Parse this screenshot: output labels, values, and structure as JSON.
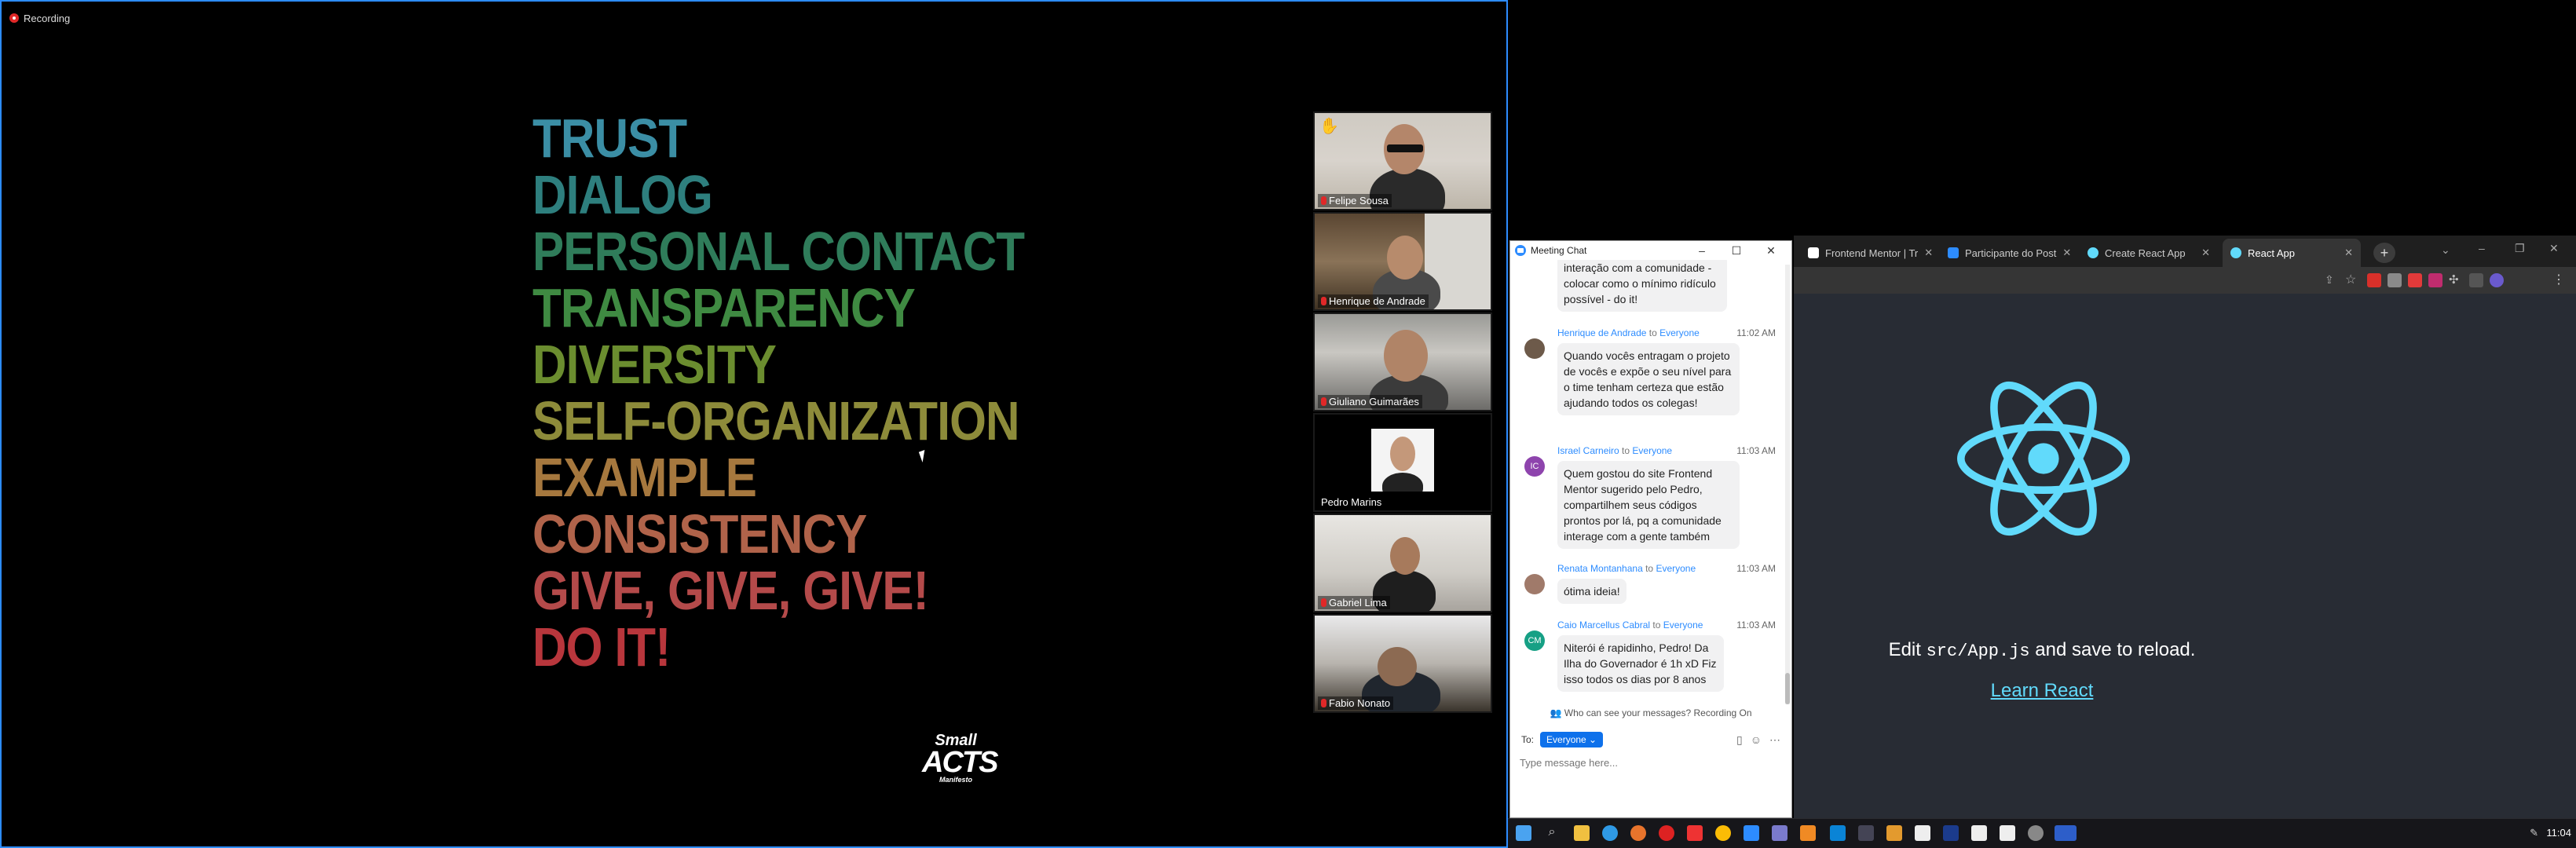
{
  "recording": {
    "label": "Recording"
  },
  "slide": {
    "words": [
      {
        "text": "TRUST",
        "color": "#3b8ea5"
      },
      {
        "text": "DIALOG",
        "color": "#2e7f7e"
      },
      {
        "text": "PERSONAL CONTACT",
        "color": "#2f7c5a"
      },
      {
        "text": "TRANSPARENCY",
        "color": "#3f8a42"
      },
      {
        "text": "DIVERSITY",
        "color": "#6b8d2f"
      },
      {
        "text": "SELF-ORGANIZATION",
        "color": "#8d8b3a"
      },
      {
        "text": "EXAMPLE",
        "color": "#a6783e"
      },
      {
        "text": "CONSISTENCY",
        "color": "#b0634a"
      },
      {
        "text": "GIVE, GIVE, GIVE!",
        "color": "#b44a4a"
      },
      {
        "text": "DO IT!",
        "color": "#b8363c"
      }
    ],
    "logo": {
      "line1": "Small",
      "line2": "ACTS",
      "line3": "Manifesto"
    }
  },
  "participants": [
    {
      "name": "Felipe Sousa",
      "raised_hand": true,
      "muted": true
    },
    {
      "name": "Henrique de Andrade",
      "raised_hand": false,
      "muted": true
    },
    {
      "name": "Giuliano Guimarães",
      "raised_hand": false,
      "muted": true
    },
    {
      "name": "Pedro Marins",
      "raised_hand": false,
      "muted": false
    },
    {
      "name": "Gabriel Lima",
      "raised_hand": false,
      "muted": true
    },
    {
      "name": "Fabio Nonato",
      "raised_hand": false,
      "muted": true
    }
  ],
  "chat": {
    "title": "Meeting Chat",
    "partial_bubble": "interação com a comunidade - colocar como o mínimo ridículo possível - do it!",
    "messages": [
      {
        "sender": "Henrique de Andrade",
        "to": "to",
        "audience": "Everyone",
        "time": "11:02 AM",
        "text": "Quando vocês entragam o projeto de vocês e expõe o seu nível para o time tenham certeza que estão ajudando todos os colegas!",
        "initials": "",
        "avatar_color": "#6d5a4a"
      },
      {
        "sender": "Israel Carneiro",
        "to": "to",
        "audience": "Everyone",
        "time": "11:03 AM",
        "text": "Quem gostou do site Frontend Mentor sugerido pelo Pedro, compartilhem seus códigos prontos por lá, pq a comunidade interage com a gente também",
        "initials": "IC",
        "avatar_color": "#8e44ad"
      },
      {
        "sender": "Renata Montanhana",
        "to": "to",
        "audience": "Everyone",
        "time": "11:03 AM",
        "text": "ótima ideia!",
        "initials": "",
        "avatar_color": "#a07a6a"
      },
      {
        "sender": "Caio Marcellus Cabral",
        "to": "to",
        "audience": "Everyone",
        "time": "11:03 AM",
        "text": "Niterói é rapidinho, Pedro! Da Ilha do Governador é 1h xD Fiz isso todos os dias por 8 anos",
        "initials": "CM",
        "avatar_color": "#16a085"
      }
    ],
    "visibility_note": "Who can see your messages? Recording On",
    "to_label": "To:",
    "to_value": "Everyone",
    "input_placeholder": "Type message here..."
  },
  "browser": {
    "tabs": [
      {
        "title": "Frontend Mentor | Tr",
        "active": false,
        "fav_color": "#ffffff"
      },
      {
        "title": "Participante do Post",
        "active": false,
        "fav_color": "#2d8cff"
      },
      {
        "title": "Create React App",
        "active": false,
        "fav_color": "#61dafb"
      },
      {
        "title": "React App",
        "active": true,
        "fav_color": "#61dafb"
      }
    ],
    "page": {
      "edit_prefix": "Edit ",
      "edit_code": "src/App.js",
      "edit_suffix": " and save to reload.",
      "link": "Learn React",
      "accent": "#61dafb"
    }
  },
  "taskbar": {
    "time": "11:04"
  }
}
